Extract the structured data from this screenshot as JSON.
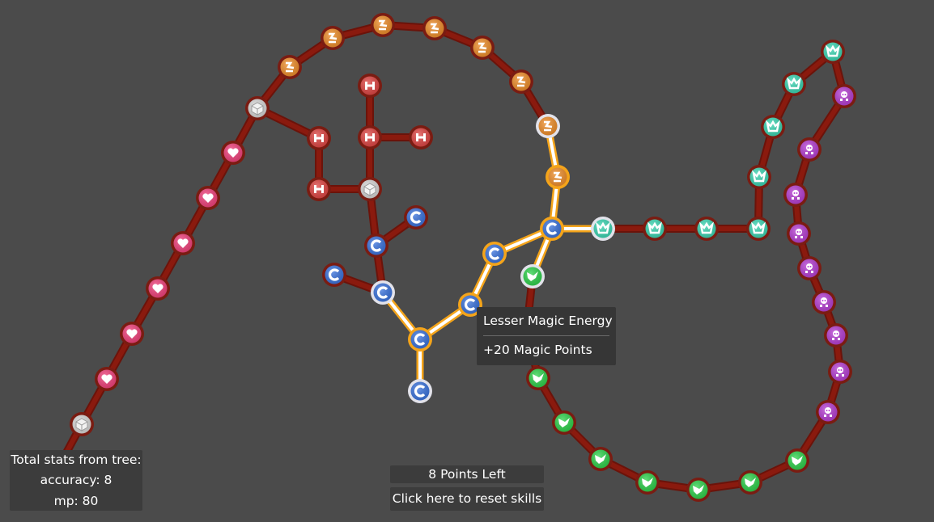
{
  "stats": {
    "title": "Total stats from tree:",
    "accuracy": "accuracy: 8",
    "mp": "mp: 80"
  },
  "points_left": "8 Points Left",
  "reset_label": "Click here to reset skills",
  "tooltip": {
    "name": "Lesser Magic Energy",
    "description": "+20 Magic Points"
  },
  "colors": {
    "background": "#4b4b4b",
    "link": "#8a1a0e",
    "link_active": "#ffffff",
    "node_ring_locked": "#7a1c12",
    "node_ring_unlocked": "#f4a41a",
    "node_ring_available": "#e2e2ea",
    "heart": "#f2427d",
    "power": "#f08f2b",
    "health": "#e04745",
    "neutral": "#d8d8d8",
    "magic": "#3b74de",
    "defense": "#3cd6b3",
    "agility": "#2fd24c",
    "arcane": "#b73fd4"
  },
  "node_types": {
    "heart": "heart-icon",
    "power": "swirl-icon",
    "health": "cross-icon",
    "neutral": "cube-icon",
    "magic": "magic-c-icon",
    "defense": "crown-icon",
    "agility": "bird-icon",
    "arcane": "skull-icon"
  }
}
